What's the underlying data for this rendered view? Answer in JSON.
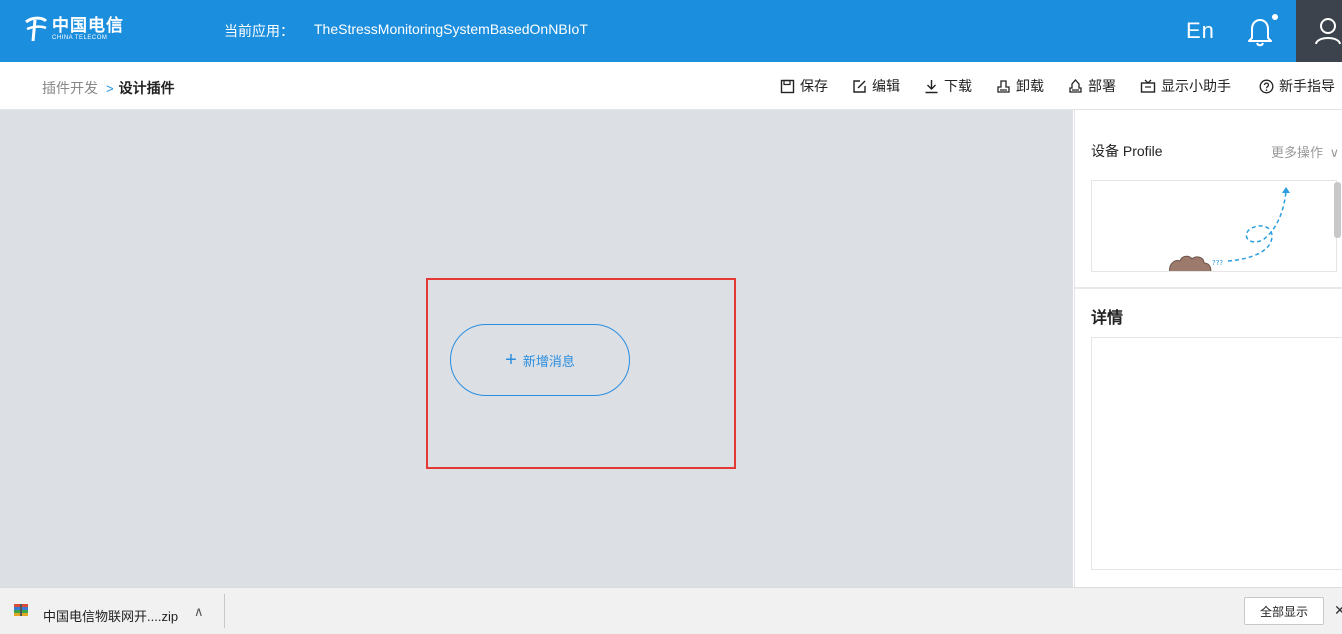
{
  "header": {
    "logo_cn": "中国电信",
    "logo_en": "CHINA TELECOM",
    "current_app_label": "当前应用：",
    "current_app_name": "TheStressMonitoringSystemBasedOnNBIoT",
    "lang_toggle": "En"
  },
  "breadcrumb": {
    "parent": "插件开发",
    "current": "设计插件"
  },
  "toolbar": {
    "save": "保存",
    "edit": "编辑",
    "download": "下载",
    "uninstall": "卸载",
    "deploy": "部署",
    "assistant": "显示小助手",
    "guide": "新手指导"
  },
  "canvas": {
    "add_message": "新增消息"
  },
  "right_panel": {
    "profile_title": "设备 Profile",
    "more_ops": "更多操作",
    "details_title": "详情"
  },
  "download_bar": {
    "file_name": "中国电信物联网开....zip",
    "show_all": "全部显示"
  },
  "colors": {
    "brand_blue": "#1c8ede",
    "canvas_bg": "#dcdfe4",
    "highlight_red": "#e53935"
  }
}
